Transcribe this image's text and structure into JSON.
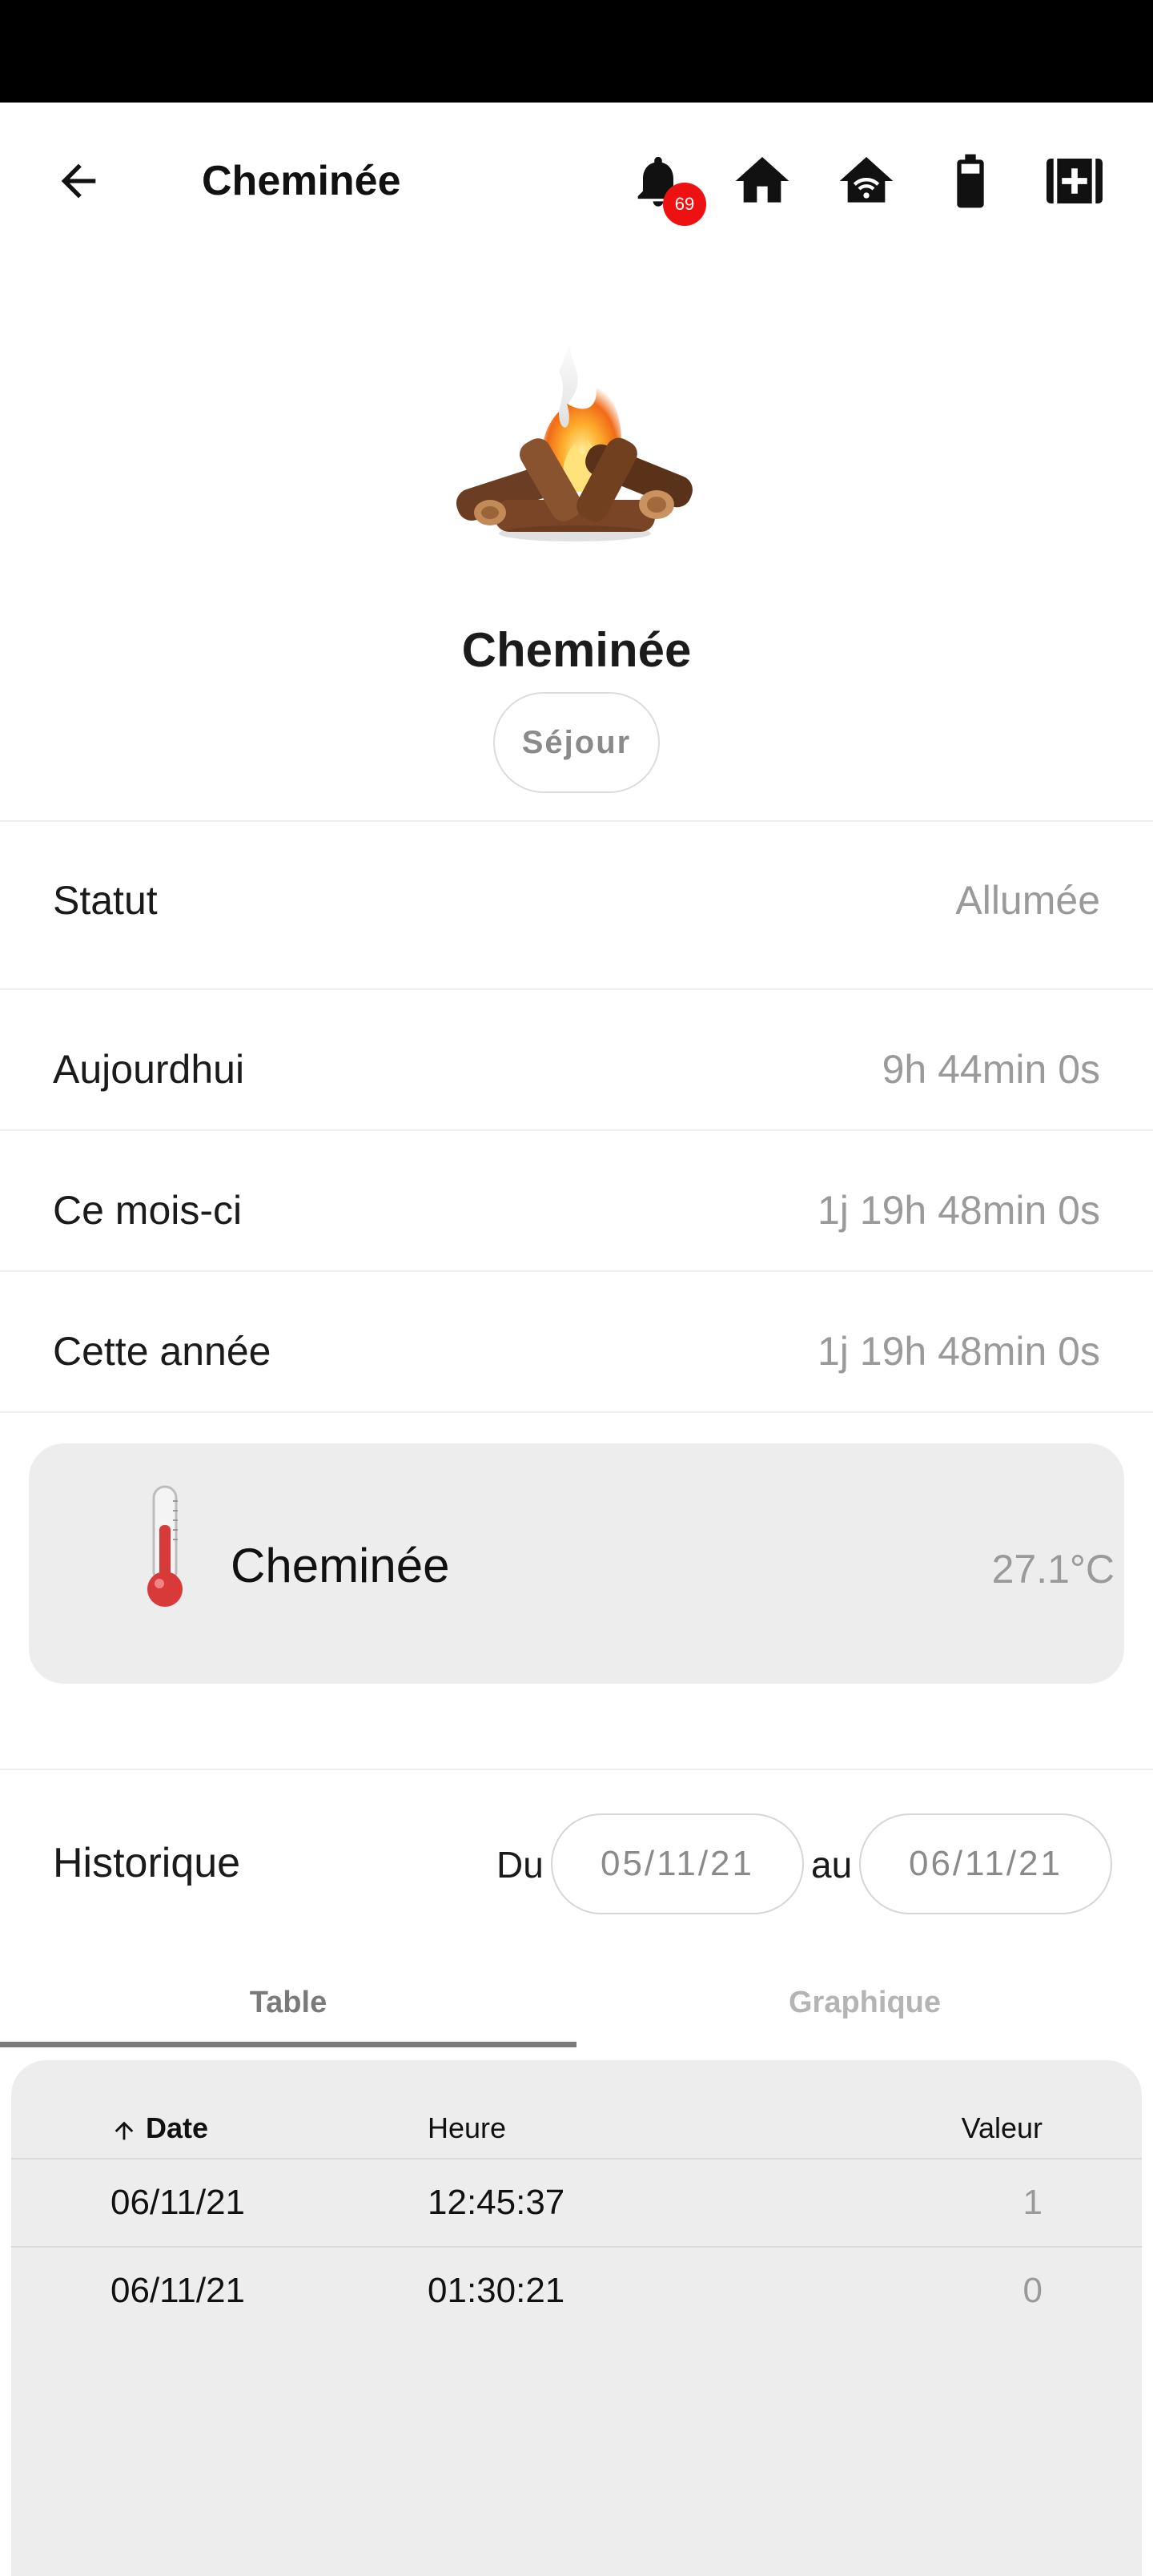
{
  "header": {
    "title": "Cheminée",
    "notification_count": "69",
    "icons": [
      "back-arrow-icon",
      "bell-icon",
      "home-icon",
      "home-wifi-icon",
      "battery-icon",
      "medical-kit-icon"
    ]
  },
  "device": {
    "name": "Cheminée",
    "room": "Séjour",
    "image": "campfire-image"
  },
  "info_rows": [
    {
      "label": "Statut",
      "value": "Allumée"
    },
    {
      "label": "Aujourdhui",
      "value": "9h 44min 0s"
    },
    {
      "label": "Ce mois-ci",
      "value": "1j 19h 48min 0s"
    },
    {
      "label": "Cette année",
      "value": "1j 19h 48min 0s"
    }
  ],
  "sensor": {
    "name": "Cheminée",
    "value": "27.1°C",
    "icon": "thermometer-icon"
  },
  "history": {
    "label": "Historique",
    "from_label": "Du",
    "from_date": "05/11/21",
    "to_label": "au",
    "to_date": "06/11/21",
    "tabs": [
      {
        "label": "Table",
        "active": true
      },
      {
        "label": "Graphique",
        "active": false
      }
    ],
    "columns": {
      "date": "Date",
      "heure": "Heure",
      "valeur": "Valeur"
    },
    "rows": [
      {
        "date": "06/11/21",
        "heure": "12:45:37",
        "valeur": "1"
      },
      {
        "date": "06/11/21",
        "heure": "01:30:21",
        "valeur": "0"
      }
    ]
  },
  "colors": {
    "badge": "#ee1111",
    "thermometer": "#d83a3a",
    "muted_text": "#9a9a9a",
    "card_bg": "#ededed",
    "inactive_tab": "#b4b4b4",
    "active_tab": "#7a7a7a"
  }
}
